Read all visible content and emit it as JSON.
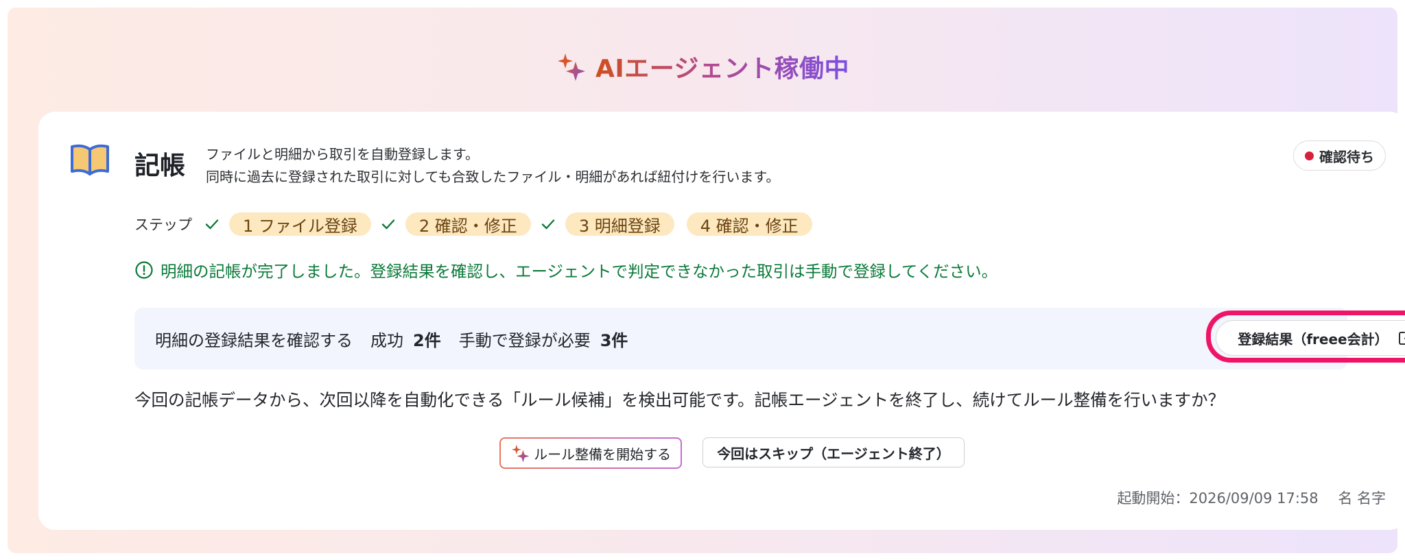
{
  "header": {
    "title": "AIエージェント稼働中"
  },
  "card": {
    "title": "記帳",
    "description_line1": "ファイルと明細から取引を自動登録します。",
    "description_line2": "同時に過去に登録された取引に対しても合致したファイル・明細があれば紐付けを行います。",
    "status_badge": "確認待ち",
    "steps_label": "ステップ",
    "steps": [
      {
        "label": "1 ファイル登録",
        "done": true
      },
      {
        "label": "2 確認・修正",
        "done": true
      },
      {
        "label": "3 明細登録",
        "done": true
      },
      {
        "label": "4 確認・修正",
        "done": false
      }
    ],
    "notice": "明細の記帳が完了しました。登録結果を確認し、エージェントで判定できなかった取引は手動で登録してください。",
    "result": {
      "lead": "明細の登録結果を確認する",
      "success_label": "成功",
      "success_count": "2件",
      "manual_label": "手動で登録が必要",
      "manual_count": "3件",
      "button_label": "登録結果（freee会計）"
    },
    "question": "今回の記帳データから、次回以降を自動化できる「ルール候補」を検出可能です。記帳エージェントを終了し、続けてルール整備を行いますか？",
    "actions": {
      "start_label": "ルール整備を開始する",
      "skip_label": "今回はスキップ（エージェント終了）"
    },
    "meta": {
      "started": "起動開始：2026/09/09 17:58",
      "user": "名 名字"
    }
  },
  "colors": {
    "notice_green": "#0b7a3a",
    "status_red": "#d81f3b",
    "highlight_pink": "#ef1466",
    "step_pill_bg": "#fde8c0",
    "title_gradient": [
      "#cf4e1e",
      "#b24a8f",
      "#7a4fe0"
    ]
  }
}
